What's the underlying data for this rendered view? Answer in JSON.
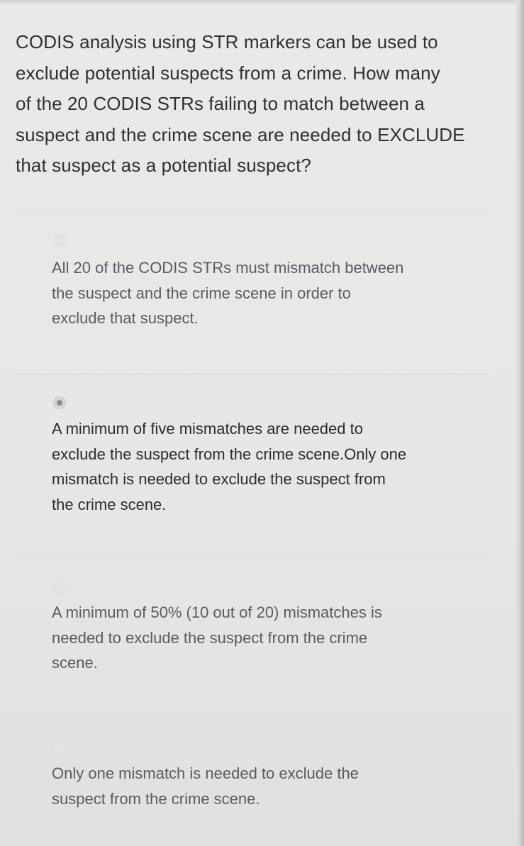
{
  "question": {
    "lines": [
      "CODIS analysis using STR markers can be used to",
      "exclude potential suspects from a crime. How many",
      "of the 20 CODIS STRs failing to match between a",
      "suspect and the crime scene are needed to EXCLUDE",
      "that suspect as a potential suspect?"
    ]
  },
  "options": [
    {
      "selected": false,
      "lines": [
        "All 20 of the CODIS STRs must mismatch between",
        "the suspect and the crime scene in order to",
        "exclude that suspect."
      ]
    },
    {
      "selected": true,
      "lines": [
        "A minimum of five mismatches are needed to",
        "exclude the suspect from the crime scene.Only one",
        "mismatch is needed to exclude the suspect from",
        "the crime scene."
      ]
    },
    {
      "selected": false,
      "lines": [
        "A minimum of 50% (10 out of 20) mismatches is",
        "needed to exclude the suspect from the crime",
        "scene."
      ]
    },
    {
      "selected": false,
      "lines": [
        "Only one mismatch is needed to exclude the",
        "suspect from the crime scene."
      ]
    }
  ]
}
